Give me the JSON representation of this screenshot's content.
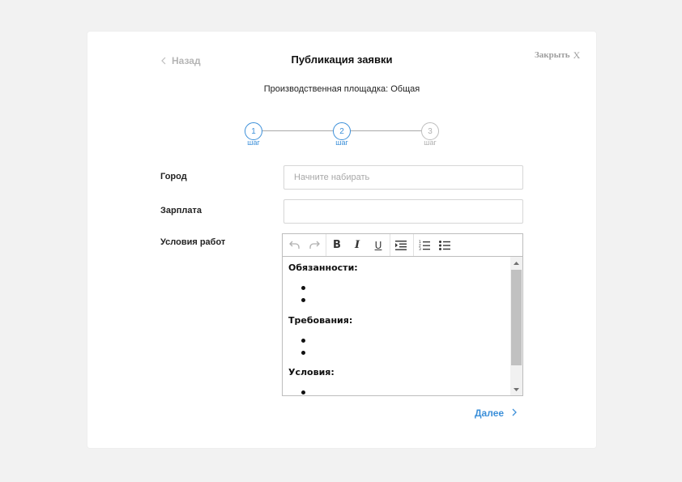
{
  "header": {
    "back_label": "Назад",
    "title": "Публикация заявки",
    "close_label": "Закрыть",
    "close_x": "X",
    "subtitle": "Производственная площадка: Общая"
  },
  "stepper": {
    "caption": "шаг",
    "steps": [
      {
        "number": "1",
        "state": "active"
      },
      {
        "number": "2",
        "state": "active"
      },
      {
        "number": "3",
        "state": "inactive"
      }
    ],
    "accent_color": "#3b8fd9",
    "inactive_color": "#b0b0b0"
  },
  "form": {
    "city_label": "Город",
    "city_placeholder": "Начните набирать",
    "city_value": "",
    "salary_label": "Зарплата",
    "salary_value": "",
    "conditions_label": "Условия работ"
  },
  "editor": {
    "toolbar": [
      "undo-icon",
      "redo-icon",
      "bold-icon",
      "italic-icon",
      "underline-icon",
      "indent-icon",
      "numbered-list-icon",
      "bulleted-list-icon"
    ],
    "bold_glyph": "B",
    "italic_glyph": "I",
    "underline_glyph": "U",
    "sections": [
      {
        "title": "Обязанности:",
        "bullets": 2
      },
      {
        "title": "Требования:",
        "bullets": 2
      },
      {
        "title": "Условия:",
        "bullets": 1
      }
    ]
  },
  "footer": {
    "next_label": "Далее"
  }
}
